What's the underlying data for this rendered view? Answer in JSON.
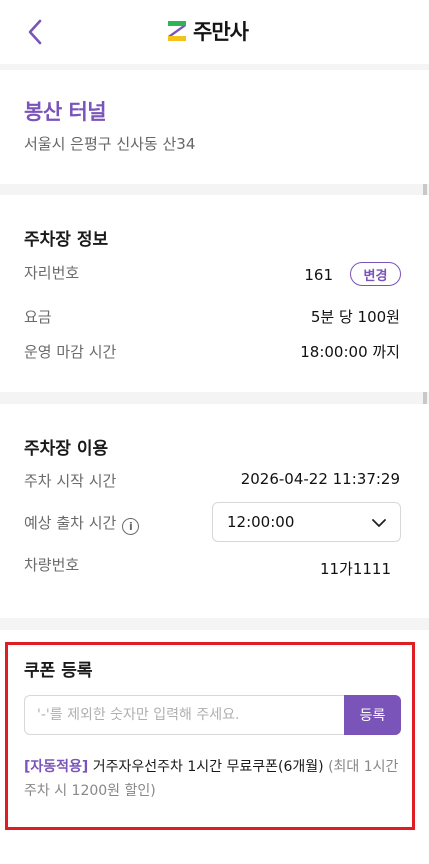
{
  "header": {
    "back_icon": "chevron-left-icon",
    "logo_text": "주만사"
  },
  "place": {
    "name": "봉산 터널",
    "address": "서울시 은평구 신사동 산34"
  },
  "parking_info": {
    "title": "주차장 정보",
    "spot_label": "자리번호",
    "spot_value": "161",
    "change_label": "변경",
    "fee_label": "요금",
    "fee_value": "5분 당 100원",
    "close_label": "운영 마감 시간",
    "close_value": "18:00:00 까지"
  },
  "parking_use": {
    "title": "주차장 이용",
    "start_label": "주차 시작 시간",
    "start_value": "2026-04-22 11:37:29",
    "exit_label": "예상 출차 시간",
    "exit_value": "12:00:00",
    "car_label": "차량번호",
    "car_value": "11가1111"
  },
  "coupon": {
    "title": "쿠폰 등록",
    "placeholder": "'-'를 제외한 숫자만 입력해 주세요.",
    "register_label": "등록",
    "auto_tag": "[자동적용]",
    "auto_name": "거주자우선주차 1시간 무료쿠폰(6개월)",
    "auto_note": "(최대 1시간 주차 시 1200원 할인)"
  },
  "colors": {
    "accent": "#7a54b9",
    "highlight": "#e11d24"
  }
}
